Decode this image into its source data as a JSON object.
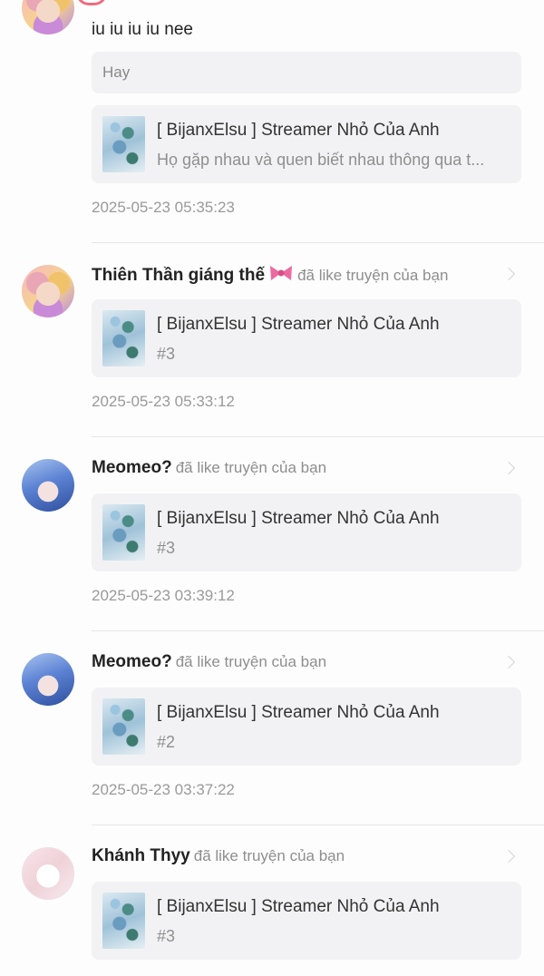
{
  "items": [
    {
      "type": "comment",
      "comment_text": "iu iu iu iu nee",
      "reply_placeholder": "Hay",
      "story_title": "[ BijanxElsu ] Streamer Nhỏ Của Anh",
      "story_subtitle": "Họ gặp nhau và quen biết nhau thông qua t...",
      "timestamp": "2025-05-23 05:35:23"
    },
    {
      "type": "like",
      "user_name": "Thiên Thần giáng thế",
      "action": "đã like truyện của bạn",
      "story_title": "[ BijanxElsu ] Streamer Nhỏ Của Anh",
      "story_subtitle": "#3",
      "timestamp": "2025-05-23 05:33:12"
    },
    {
      "type": "like",
      "user_name": "Meomeo?",
      "action": "đã like truyện của bạn",
      "story_title": "[ BijanxElsu ] Streamer Nhỏ Của Anh",
      "story_subtitle": "#3",
      "timestamp": "2025-05-23 03:39:12"
    },
    {
      "type": "like",
      "user_name": "Meomeo?",
      "action": "đã like truyện của bạn",
      "story_title": "[ BijanxElsu ] Streamer Nhỏ Của Anh",
      "story_subtitle": "#2",
      "timestamp": "2025-05-23 03:37:22"
    },
    {
      "type": "like",
      "user_name": "Khánh Thyy",
      "action": "đã like truyện của bạn",
      "story_title": "[ BijanxElsu ] Streamer Nhỏ Của Anh",
      "story_subtitle": "#3"
    }
  ],
  "icons": {
    "bow": "pink-bow-icon",
    "chevron": "chevron-right-icon"
  },
  "colors": {
    "card_background": "#f2f2f4",
    "muted_text": "#8e8e8e",
    "bow_pink": "#ec6aa0"
  }
}
